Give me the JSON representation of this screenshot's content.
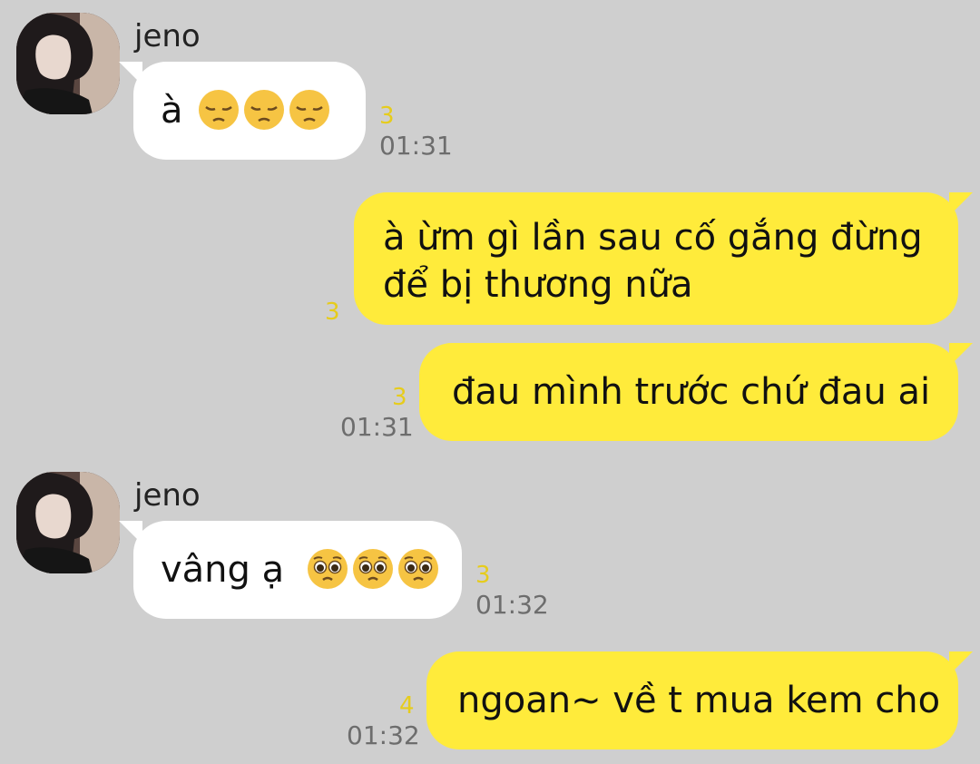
{
  "messages": [
    {
      "sender": "jeno",
      "text": "à",
      "emojis": [
        "pensive-face",
        "pensive-face",
        "pensive-face"
      ],
      "unread": "3",
      "time": "01:31"
    },
    {
      "text_line1": "à ừm gì lần sau cố gắng đừng",
      "text_line2": "để bị thương nữa",
      "unread": "3"
    },
    {
      "text": "đau mình trước chứ đau ai",
      "unread": "3",
      "time": "01:31"
    },
    {
      "sender": "jeno",
      "text": "vâng ạ",
      "emojis": [
        "pleading-face",
        "pleading-face",
        "pleading-face"
      ],
      "unread": "3",
      "time": "01:32"
    },
    {
      "text": "ngoan~ về t mua kem cho",
      "unread": "4",
      "time": "01:32"
    }
  ],
  "colors": {
    "background": "#cfcfcf",
    "incoming_bubble": "#ffffff",
    "outgoing_bubble": "#ffeb3b",
    "unread_count": "#e6cc1c",
    "timestamp": "#6d6d6d"
  }
}
